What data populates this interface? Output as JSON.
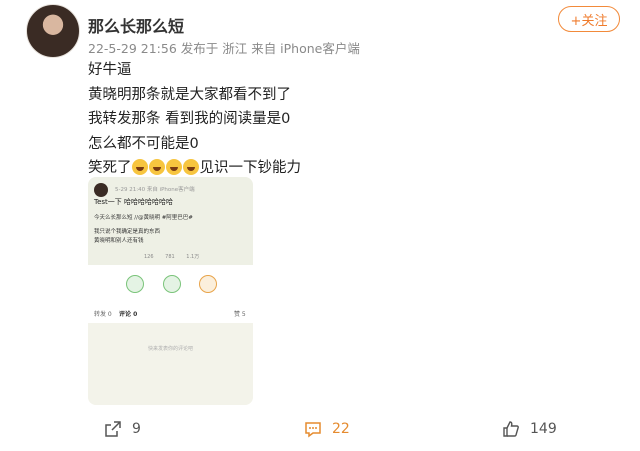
{
  "post": {
    "username": "那么长那么短",
    "meta": "22-5-29 21:56  发布于 浙江  来自 iPhone客户端",
    "follow_label": "+关注",
    "lines": [
      "好牛逼",
      "黄晓明那条就是大家都看不到了",
      "我转发那条 看到我的阅读量是0",
      "怎么都不可能是0"
    ],
    "last_line_start": "笑死了",
    "last_line_end": "见识一下钞能力"
  },
  "screenshot": {
    "meta": "5-29 21:40  来自 iPhone客户端",
    "title": "Test一下 哈哈哈哈哈哈哈",
    "body": [
      "今天么长那么短 //@黄晓明 #阿里巴巴#",
      "我只说个我确定是真的东西",
      "黄晓明和别人还有钱"
    ],
    "stats": [
      "126",
      "781",
      "1.1万"
    ],
    "tabs": [
      "转发 0",
      "评论 0",
      "赞 5"
    ],
    "empty_text": "快来发表你的评论吧"
  },
  "actions": {
    "repost_count": "9",
    "comment_count": "22",
    "like_count": "149"
  },
  "colors": {
    "accent": "#ef7b2c",
    "comment_accent": "#e58b2f",
    "emoji": "#f7c53f"
  },
  "icons": [
    "repost-icon",
    "comment-icon",
    "like-icon",
    "laugh-emoji-icon"
  ]
}
